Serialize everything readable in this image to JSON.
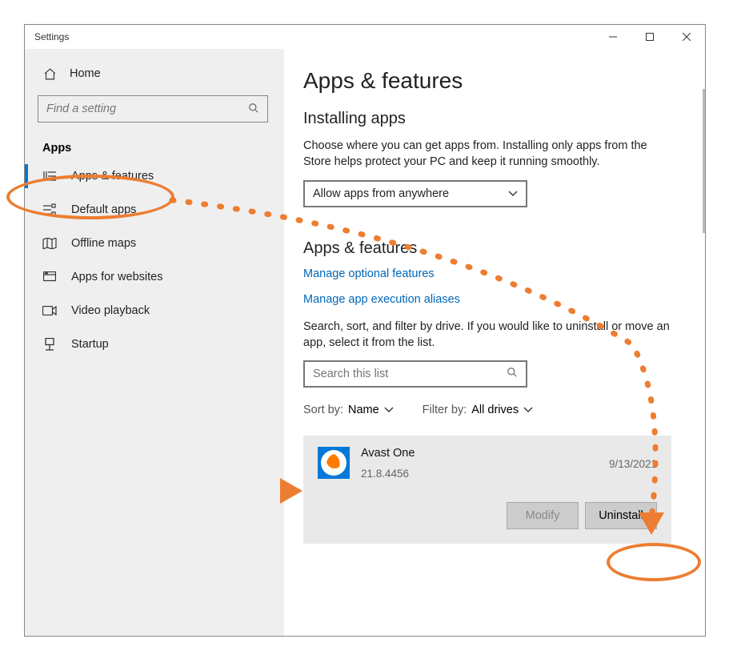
{
  "window": {
    "title": "Settings"
  },
  "sidebar": {
    "home": "Home",
    "search_placeholder": "Find a setting",
    "section": "Apps",
    "items": [
      {
        "label": "Apps & features"
      },
      {
        "label": "Default apps"
      },
      {
        "label": "Offline maps"
      },
      {
        "label": "Apps for websites"
      },
      {
        "label": "Video playback"
      },
      {
        "label": "Startup"
      }
    ]
  },
  "main": {
    "title": "Apps & features",
    "installing_head": "Installing apps",
    "installing_desc": "Choose where you can get apps from. Installing only apps from the Store helps protect your PC and keep it running smoothly.",
    "install_source": "Allow apps from anywhere",
    "apps_head": "Apps & features",
    "link_optional": "Manage optional features",
    "link_aliases": "Manage app execution aliases",
    "search_desc": "Search, sort, and filter by drive. If you would like to uninstall or move an app, select it from the list.",
    "list_search_placeholder": "Search this list",
    "sort_label": "Sort by:",
    "sort_value": "Name",
    "filter_label": "Filter by:",
    "filter_value": "All drives",
    "app": {
      "name": "Avast One",
      "version": "21.8.4456",
      "date": "9/13/2021",
      "modify": "Modify",
      "uninstall": "Uninstall"
    }
  }
}
